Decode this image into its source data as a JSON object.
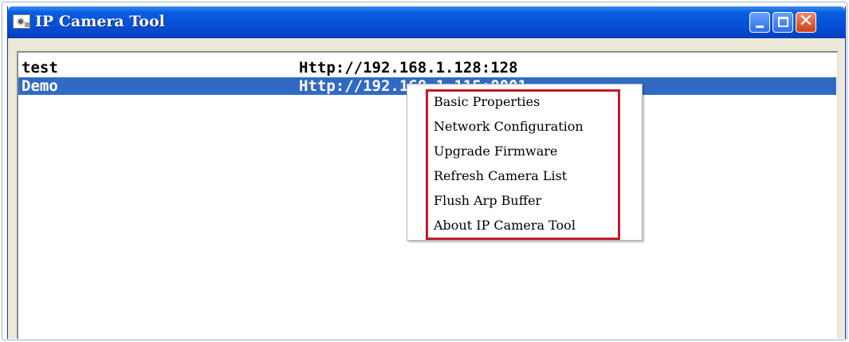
{
  "window": {
    "title": "IP Camera Tool",
    "title_icon": "camera-icon",
    "controls": {
      "minimize": "minimize-icon",
      "maximize": "maximize-icon",
      "close_glyph": "✕"
    }
  },
  "camera_list": {
    "rows": [
      {
        "name": "test",
        "url": "Http://192.168.1.128:128",
        "selected": false
      },
      {
        "name": "Demo",
        "url": "Http://192.168.1.115:8001",
        "selected": true
      }
    ]
  },
  "context_menu": {
    "items": [
      {
        "label": "Basic Properties"
      },
      {
        "label": "Network Configuration"
      },
      {
        "label": "Upgrade Firmware"
      },
      {
        "label": "Refresh Camera List"
      },
      {
        "label": "Flush Arp Buffer"
      },
      {
        "label": "About IP Camera Tool"
      }
    ],
    "highlight_color": "#c01c28"
  },
  "colors": {
    "titlebar": "#0552d6",
    "selection": "#316ac5",
    "window_body": "#ece9d8"
  }
}
